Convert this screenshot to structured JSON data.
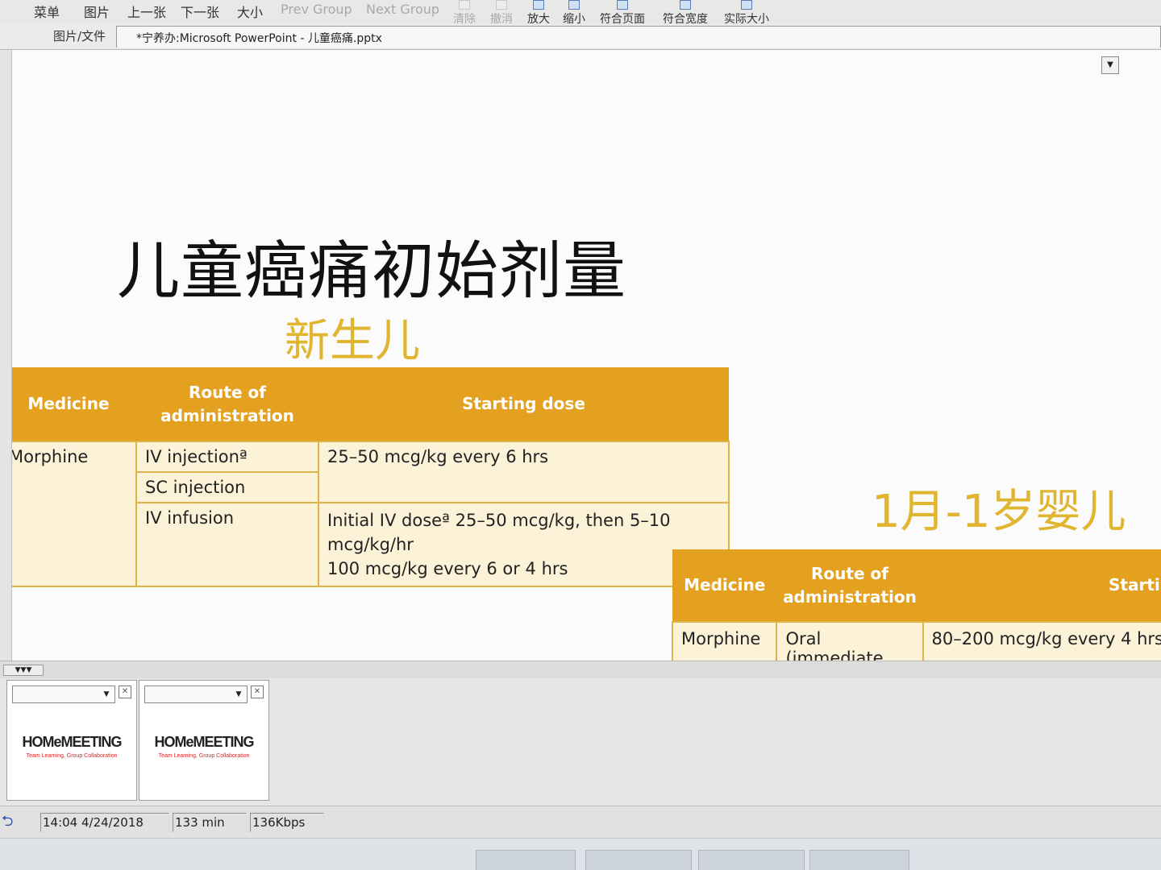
{
  "toolbar": {
    "menu": "菜单",
    "pictures": "图片",
    "prev": "上一张",
    "next": "下一张",
    "size": "大小",
    "prev_group": "Prev Group",
    "next_group": "Next Group",
    "clear": "清除",
    "undo": "撤消",
    "zoom_in": "放大",
    "zoom_out": "缩小",
    "fit_page": "符合页面",
    "fit_width": "符合宽度",
    "actual_size": "实际大小"
  },
  "address": {
    "label": "图片/文件",
    "value": "*宁养办:Microsoft PowerPoint - 儿童癌痛.pptx"
  },
  "slide": {
    "title": "儿童癌痛初始剂量",
    "section_newborn": "新生儿",
    "section_infant": "1月-1岁婴儿",
    "table1": {
      "headers": [
        "Medicine",
        "Route of\nadministration",
        "Starting dose"
      ],
      "medicine": "Morphine",
      "routes": [
        "IV injectionª",
        "SC injection",
        "IV infusion"
      ],
      "dose_injection": "25–50 mcg/kg every 6 hrs",
      "dose_infusion_1": "Initial IV doseª 25–50 mcg/kg, then 5–10 mcg/kg/hr",
      "dose_infusion_2": "100 mcg/kg every 6 or 4 hrs"
    },
    "table2": {
      "headers": [
        "Medicine",
        "Route of\nadministration",
        "Startin"
      ],
      "medicine": "Morphine",
      "route": "Oral (immediate",
      "dose": "80–200 mcg/kg every 4 hrs"
    }
  },
  "thumbnails": [
    {
      "logo": "HOMeMEETING",
      "tagline": "Team Learning, Group Collaboration"
    },
    {
      "logo": "HOMeMEETING",
      "tagline": "Team Learning, Group Collaboration"
    }
  ],
  "status": {
    "datetime": "14:04 4/24/2018",
    "duration": "133 min",
    "bitrate": "136Kbps"
  },
  "colors": {
    "header_orange": "#e4a120",
    "subtitle_gold": "#e0b530",
    "cell_cream": "#fbf2d8"
  }
}
